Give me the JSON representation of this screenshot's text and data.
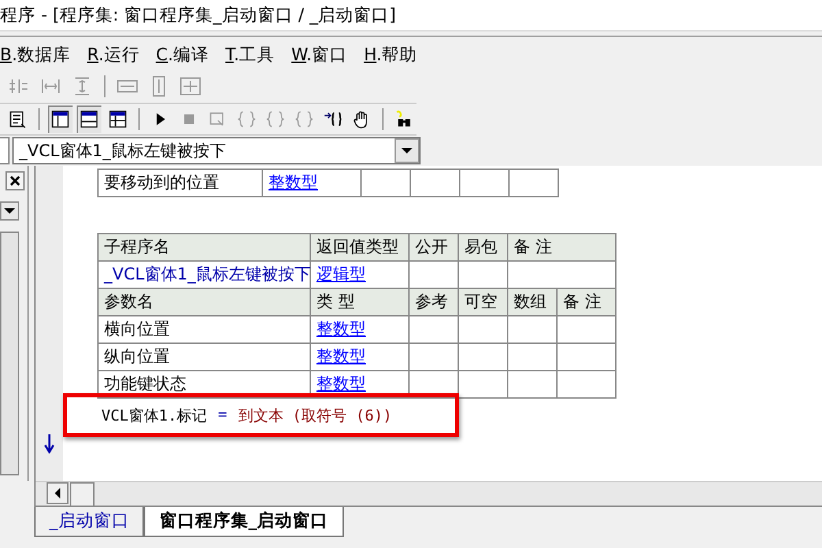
{
  "window": {
    "title": "程序 - [程序集: 窗口程序集_启动窗口 / _启动窗口]"
  },
  "menu": [
    {
      "accel": "B",
      "label": ".数据库"
    },
    {
      "accel": "R",
      "label": ".运行"
    },
    {
      "accel": "C",
      "label": ".编译"
    },
    {
      "accel": "T",
      "label": ".工具"
    },
    {
      "accel": "W",
      "label": ".窗口"
    },
    {
      "accel": "H",
      "label": ".帮助"
    }
  ],
  "method_selector": {
    "value": "_VCL窗体1_鼠标左键被按下"
  },
  "param_table_tail": {
    "rows": [
      {
        "name": "要移动到的位置",
        "type": "整数型"
      }
    ]
  },
  "subroutine_table": {
    "header": [
      "子程序名",
      "返回值类型",
      "公开",
      "易包",
      "备 注"
    ],
    "subroutine": {
      "name": "_VCL窗体1_鼠标左键被按下",
      "return_type": "逻辑型"
    },
    "param_header": [
      "参数名",
      "类 型",
      "参考",
      "可空",
      "数组",
      "备 注"
    ],
    "params": [
      {
        "name": "横向位置",
        "type": "整数型"
      },
      {
        "name": "纵向位置",
        "type": "整数型"
      },
      {
        "name": "功能键状态",
        "type": "整数型"
      }
    ]
  },
  "code_line": {
    "highlighted": true,
    "parts": [
      {
        "kind": "variable",
        "text": "VCL窗体1.标记"
      },
      {
        "kind": "operator",
        "text": "="
      },
      {
        "kind": "command",
        "text": "到文本 (取符号 (6))"
      }
    ]
  },
  "tabs": [
    {
      "label": "_启动窗口",
      "selected": false
    },
    {
      "label": "窗口程序集_启动窗口",
      "selected": true
    }
  ]
}
